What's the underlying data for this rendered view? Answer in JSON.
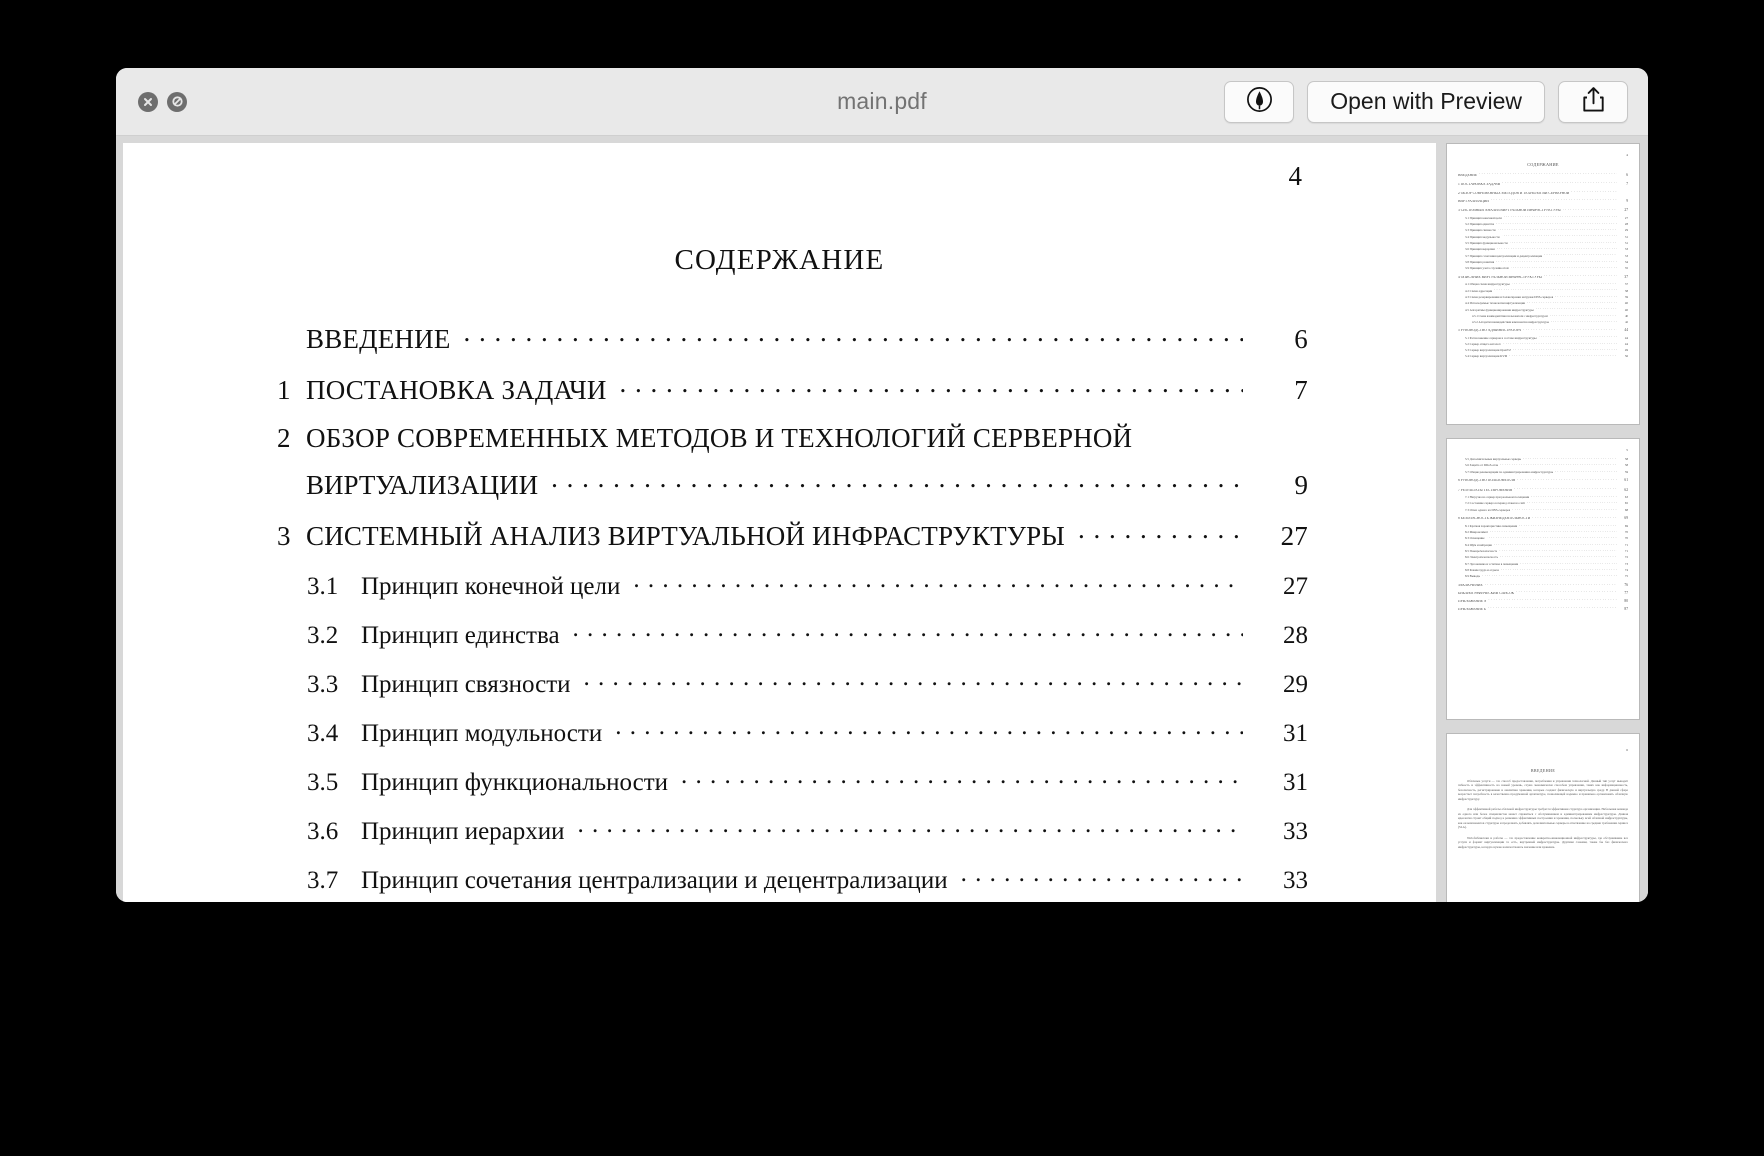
{
  "window": {
    "title": "main.pdf",
    "close_icon": "close-x-icon",
    "minimize_icon": "no-entry-slash-icon"
  },
  "toolbar": {
    "markup_icon": "markup-pen-circle-icon",
    "open_with_preview_label": "Open with Preview",
    "share_icon": "share-upload-icon"
  },
  "document": {
    "folio": "4",
    "heading": "СОДЕРЖАНИЕ",
    "entries": [
      {
        "level": 0,
        "num": "",
        "title": "ВВЕДЕНИЕ",
        "page": "6"
      },
      {
        "level": 0,
        "num": "1",
        "title": "ПОСТАНОВКА ЗАДАЧИ",
        "page": "7"
      },
      {
        "level": 0,
        "num": "2",
        "title": "ОБЗОР СОВРЕМЕННЫХ МЕТОДОВ И ТЕХНОЛОГИЙ СЕРВЕРНОЙ",
        "title_cont": "ВИРТУАЛИЗАЦИИ",
        "page": "9"
      },
      {
        "level": 0,
        "num": "3",
        "title": "СИСТЕМНЫЙ АНАЛИЗ ВИРТУАЛЬНОЙ ИНФРАСТРУКТУРЫ",
        "page": "27"
      },
      {
        "level": 1,
        "num": "3.1",
        "title": "Принцип конечной цели",
        "page": "27"
      },
      {
        "level": 1,
        "num": "3.2",
        "title": "Принцип единства",
        "page": "28"
      },
      {
        "level": 1,
        "num": "3.3",
        "title": "Принцип связности",
        "page": "29"
      },
      {
        "level": 1,
        "num": "3.4",
        "title": "Принцип модульности",
        "page": "31"
      },
      {
        "level": 1,
        "num": "3.5",
        "title": "Принцип функциональности",
        "page": "31"
      },
      {
        "level": 1,
        "num": "3.6",
        "title": "Принцип иерархии",
        "page": "33"
      },
      {
        "level": 1,
        "num": "3.7",
        "title": "Принцип сочетания централизации и децентрализации",
        "page": "33"
      }
    ]
  },
  "thumbnails": [
    {
      "name": "thumbnail-page-4",
      "folio": "4",
      "heading": "СОДЕРЖАНИЕ",
      "rows": [
        {
          "cls": "",
          "text": "ВВЕДЕНИЕ",
          "page": "6"
        },
        {
          "cls": "major",
          "text": "1 ПОСТАНОВКА ЗАДАЧИ",
          "page": "7"
        },
        {
          "cls": "major",
          "text": "2 ОБЗОР СОВРЕМЕННЫХ МЕТОДОВ И ТЕХНОЛОГИЙ СЕРВЕРНОЙ",
          "page": ""
        },
        {
          "cls": "",
          "text": "ВИРТУАЛИЗАЦИИ",
          "page": "9"
        },
        {
          "cls": "major",
          "text": "3 СИСТЕМНЫЙ АНАЛИЗ ВИРТУАЛЬНОЙ ИНФРАСТРУКТУРЫ",
          "page": "27"
        },
        {
          "cls": "sub",
          "text": "3.1 Принцип конечной цели",
          "page": "27"
        },
        {
          "cls": "sub",
          "text": "3.2 Принцип единства",
          "page": "28"
        },
        {
          "cls": "sub",
          "text": "3.3 Принцип связности",
          "page": "29"
        },
        {
          "cls": "sub",
          "text": "3.4 Принцип модульности",
          "page": "31"
        },
        {
          "cls": "sub",
          "text": "3.5 Принцип функциональности",
          "page": "31"
        },
        {
          "cls": "sub",
          "text": "3.6 Принцип иерархии",
          "page": "33"
        },
        {
          "cls": "sub",
          "text": "3.7 Принцип сочетания централизации и децентрализации",
          "page": "33"
        },
        {
          "cls": "sub",
          "text": "3.8 Принцип развития",
          "page": "34"
        },
        {
          "cls": "sub",
          "text": "3.9 Принцип учета случайностей",
          "page": "35"
        },
        {
          "cls": "major",
          "text": "4 ОПИСАНИЕ ВИРТУАЛЬНОЙ ИНФРАСТРУКТУРЫ",
          "page": "37"
        },
        {
          "cls": "sub",
          "text": "4.1 Общая схема инфраструктуры",
          "page": "37"
        },
        {
          "cls": "sub",
          "text": "4.2 Схема адресации",
          "page": "38"
        },
        {
          "cls": "sub",
          "text": "4.3 Схема резервирования и балансировки нагрузки DNS-серверов",
          "page": "39"
        },
        {
          "cls": "sub",
          "text": "4.4 Используемые технологии виртуализации",
          "page": "40"
        },
        {
          "cls": "sub",
          "text": "4.5 Алгоритмы функционирования инфраструктуры",
          "page": "40"
        },
        {
          "cls": "sub2",
          "text": "4.5.1 Схема взаимодействия пользователя с инфраструктурой",
          "page": "40"
        },
        {
          "cls": "sub2",
          "text": "4.5.2 Алгоритм взаимодействия компонентов инфраструктуры",
          "page": "42"
        },
        {
          "cls": "major",
          "text": "5 РУКОВОДСТВО АДМИНИСТРАТОРА",
          "page": "44"
        },
        {
          "cls": "sub",
          "text": "5.1 Расположение серверов в составе инфраструктуры",
          "page": "44"
        },
        {
          "cls": "sub",
          "text": "5.2 Сервер общего каталога",
          "page": "44"
        },
        {
          "cls": "sub",
          "text": "5.3 Сервер виртуализации OpenVZ",
          "page": "49"
        },
        {
          "cls": "sub",
          "text": "5.4 Сервер виртуализации KVM",
          "page": "56"
        }
      ]
    },
    {
      "name": "thumbnail-page-5",
      "folio": "5",
      "heading": "",
      "rows": [
        {
          "cls": "sub",
          "text": "5.5 Дополнительные виртуальные серверы",
          "page": "58"
        },
        {
          "cls": "sub",
          "text": "5.6 Защита от DDoS-атак",
          "page": "58"
        },
        {
          "cls": "sub",
          "text": "5.7 Общие рекомендации по администрированию инфраструктуры",
          "page": "59"
        },
        {
          "cls": "major",
          "text": "6 РУКОВОДСТВО ПОЛЬЗОВАТЕЛЯ",
          "page": "61"
        },
        {
          "cls": "major",
          "text": "7 РЕЗУЛЬТАТЫ ТЕСТИРОВАНИЯ",
          "page": "62"
        },
        {
          "cls": "sub",
          "text": "7.1 Нагрузка на сервер при реальном посещении",
          "page": "63"
        },
        {
          "cls": "sub",
          "text": "7.2 Состояние сервера в период атаки на сайт",
          "page": "65"
        },
        {
          "cls": "sub",
          "text": "7.3 Отказ одного из DNS-серверов",
          "page": "68"
        },
        {
          "cls": "major",
          "text": "8 БЕЗОПАСНОСТЬ ЖИЗНЕДЕЯТЕЛЬНОСТИ",
          "page": "69"
        },
        {
          "cls": "sub",
          "text": "8.1 Краткая характеристика помещения",
          "page": "69"
        },
        {
          "cls": "sub",
          "text": "8.2 Микроклимат",
          "page": "70"
        },
        {
          "cls": "sub",
          "text": "8.3 Освещение",
          "page": "70"
        },
        {
          "cls": "sub",
          "text": "8.4 Шум и вибрация",
          "page": "71"
        },
        {
          "cls": "sub",
          "text": "8.5 Пожаробезопасность",
          "page": "71"
        },
        {
          "cls": "sub",
          "text": "8.6 Электробезопасность",
          "page": "72"
        },
        {
          "cls": "sub",
          "text": "8.7 Эргономика и эстетика в помещении",
          "page": "73"
        },
        {
          "cls": "sub",
          "text": "8.8 Режим труда и отдыха",
          "page": "74"
        },
        {
          "cls": "sub",
          "text": "8.9 Выводы",
          "page": "75"
        },
        {
          "cls": "major",
          "text": "ЗАКЛЮЧЕНИЕ",
          "page": "76"
        },
        {
          "cls": "",
          "text": "БИБЛИОГРАФИЧЕСКИЙ СПИСОК",
          "page": "77"
        },
        {
          "cls": "",
          "text": "ПРИЛОЖЕНИЕ А",
          "page": "80"
        },
        {
          "cls": "",
          "text": "ПРИЛОЖЕНИЕ Б",
          "page": "87"
        }
      ]
    },
    {
      "name": "thumbnail-page-6",
      "folio": "6",
      "heading": "ВВЕДЕНИЕ",
      "paragraphs": [
        "Облачные услуги — это способ предоставления, потребления и управления технологией. Данный тип услуг выводит гибкость и эффективность на новый уровень, служа экономически способом управления, таких как информационность, безопасность, регистрирование и аналитика хранения, которые создают физическую и виртуальную среду. В данной сфере возрастает потребность в качественно продуманной архитектуре, позволяющей надежно и правильно организовать облачную инфраструктуру.",
        "Для эффективной работы облачной инфраструктуры требуется эффективная структура организации. Небольшая команда из одного или более специалистов может справиться с обслуживанием и администрированием инфраструктуры. Данная идеология строит общий подход к решению эффективных построения и хранения, поскольку всей облачной инфраструктуры, как он компонентов структуры и продолжать добавлять дополнительные серверы в ответвление на средние требования сервиса (SLA).",
        "Web-библиотеки и работы — это предоставление конкретно-инновационной инфраструктуры, где обслуживание все услуги и формат виртуализации то есть, внутренней инфраструктуры. Другими словами, также бы без физического инфраструктуры, которую нужно наличествовать значение или хранение."
      ]
    }
  ]
}
